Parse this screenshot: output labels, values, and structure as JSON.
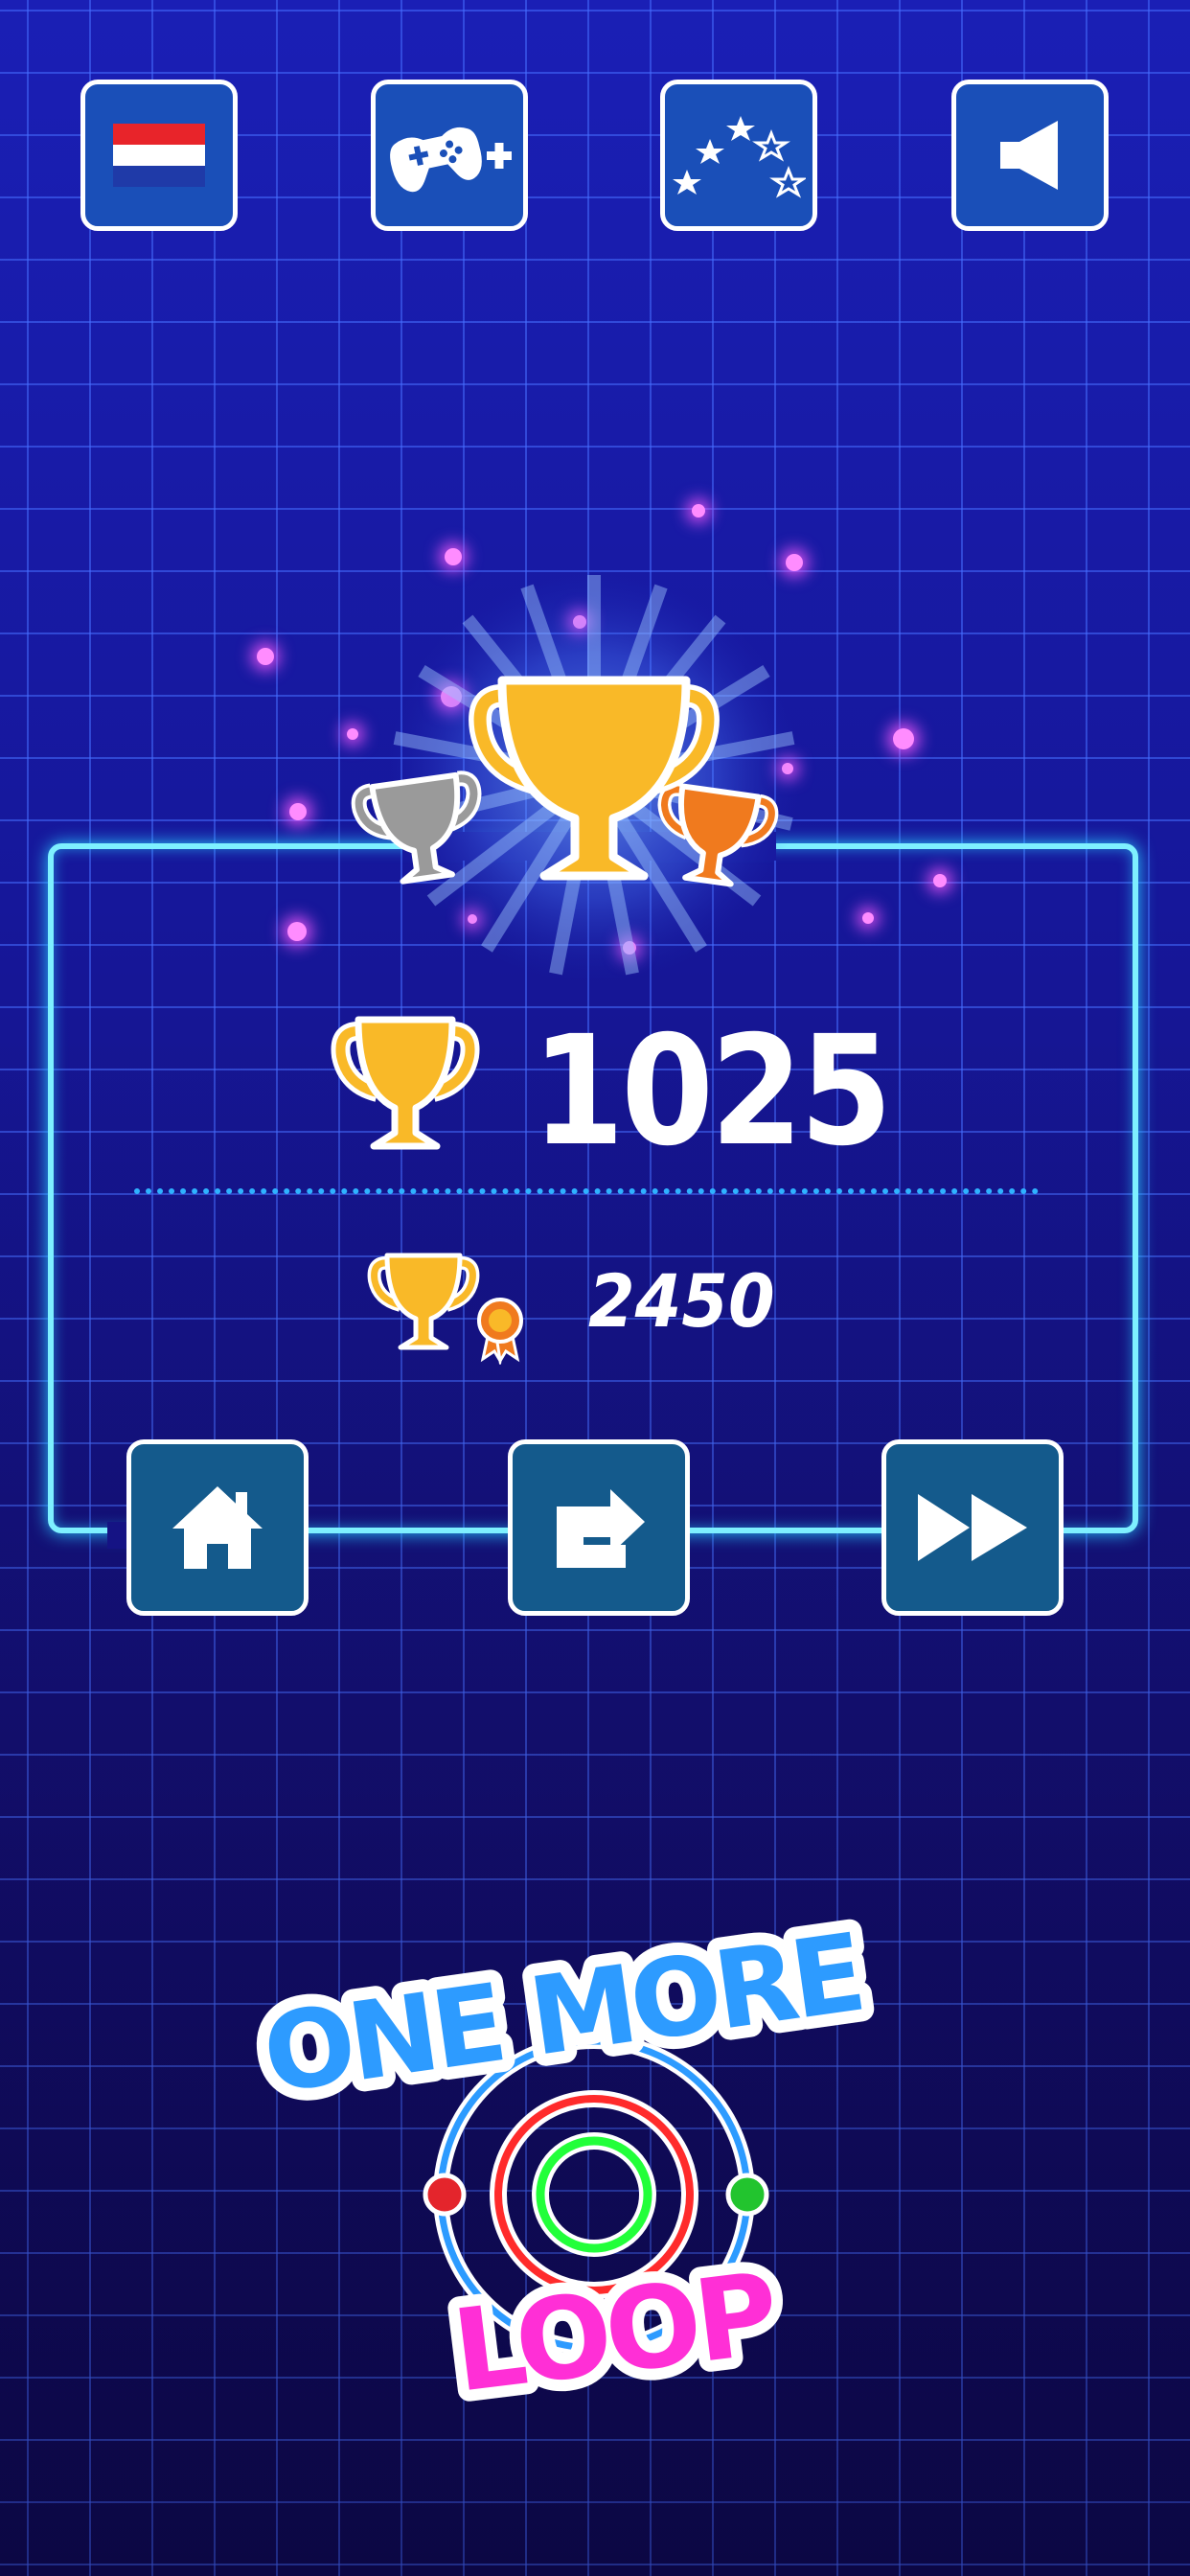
{
  "top_bar": {
    "language_button": {
      "icon": "netherlands-flag-icon"
    },
    "more_games_button": {
      "icon": "gamepad-plus-icon"
    },
    "rate_button": {
      "icon": "stars-icon"
    },
    "sound_button": {
      "icon": "speaker-icon"
    }
  },
  "results": {
    "trophies_earned": "1025",
    "best_trophies": "2450",
    "podium": [
      "silver",
      "gold",
      "bronze"
    ]
  },
  "actions": {
    "home_button": {
      "icon": "home-icon"
    },
    "replay_button": {
      "icon": "replay-icon"
    },
    "next_button": {
      "icon": "fast-forward-icon"
    }
  },
  "logo": {
    "line1": "ONE MORE",
    "line2": "LOOP"
  },
  "colors": {
    "background": "#1616a0",
    "grid": "#466eff",
    "glow_frame": "#7ef0ff",
    "button_fill_top": "#1a4fb8",
    "button_fill_bottom": "#145a8c",
    "gold": "#f9b928",
    "silver": "#9a9a9a",
    "bronze": "#f07a1e",
    "sparkle": "#ff8cff",
    "logo_blue": "#2d9bff",
    "logo_pink": "#ff2fd6"
  }
}
